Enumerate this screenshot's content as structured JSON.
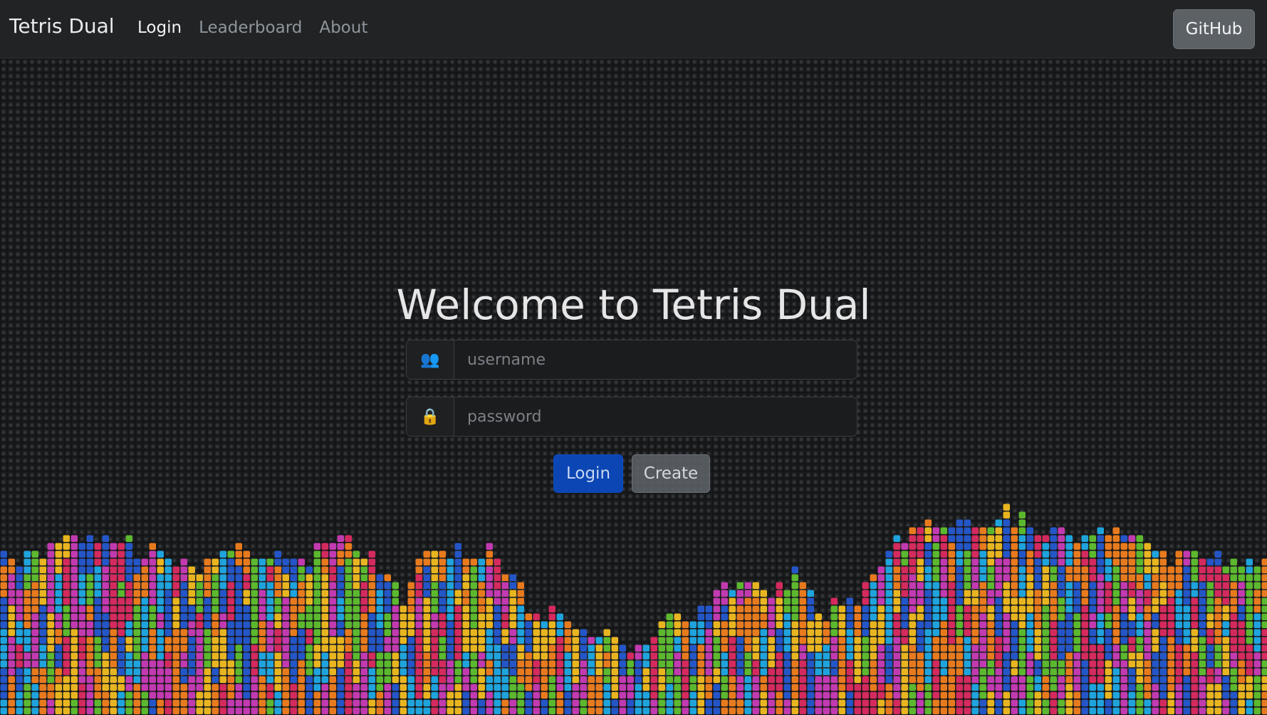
{
  "navbar": {
    "brand": "Tetris Dual",
    "links": [
      {
        "label": "Login",
        "active": true
      },
      {
        "label": "Leaderboard",
        "active": false
      },
      {
        "label": "About",
        "active": false
      }
    ],
    "github_label": "GitHub"
  },
  "main": {
    "title": "Welcome to Tetris Dual",
    "username": {
      "value": "",
      "placeholder": "username",
      "icon": "users-icon"
    },
    "password": {
      "value": "",
      "placeholder": "password",
      "icon": "lock-icon"
    },
    "login_label": "Login",
    "create_label": "Create"
  },
  "colors": {
    "background": "#1c1d1f",
    "navbar": "#212325",
    "primary": "#0b46b4",
    "secondary": "#5c6166",
    "block_palette": [
      "#e8b520",
      "#d42a5e",
      "#1fa3dc",
      "#5cb82e",
      "#e87a1e",
      "#2456c8",
      "#c23ab0"
    ]
  }
}
